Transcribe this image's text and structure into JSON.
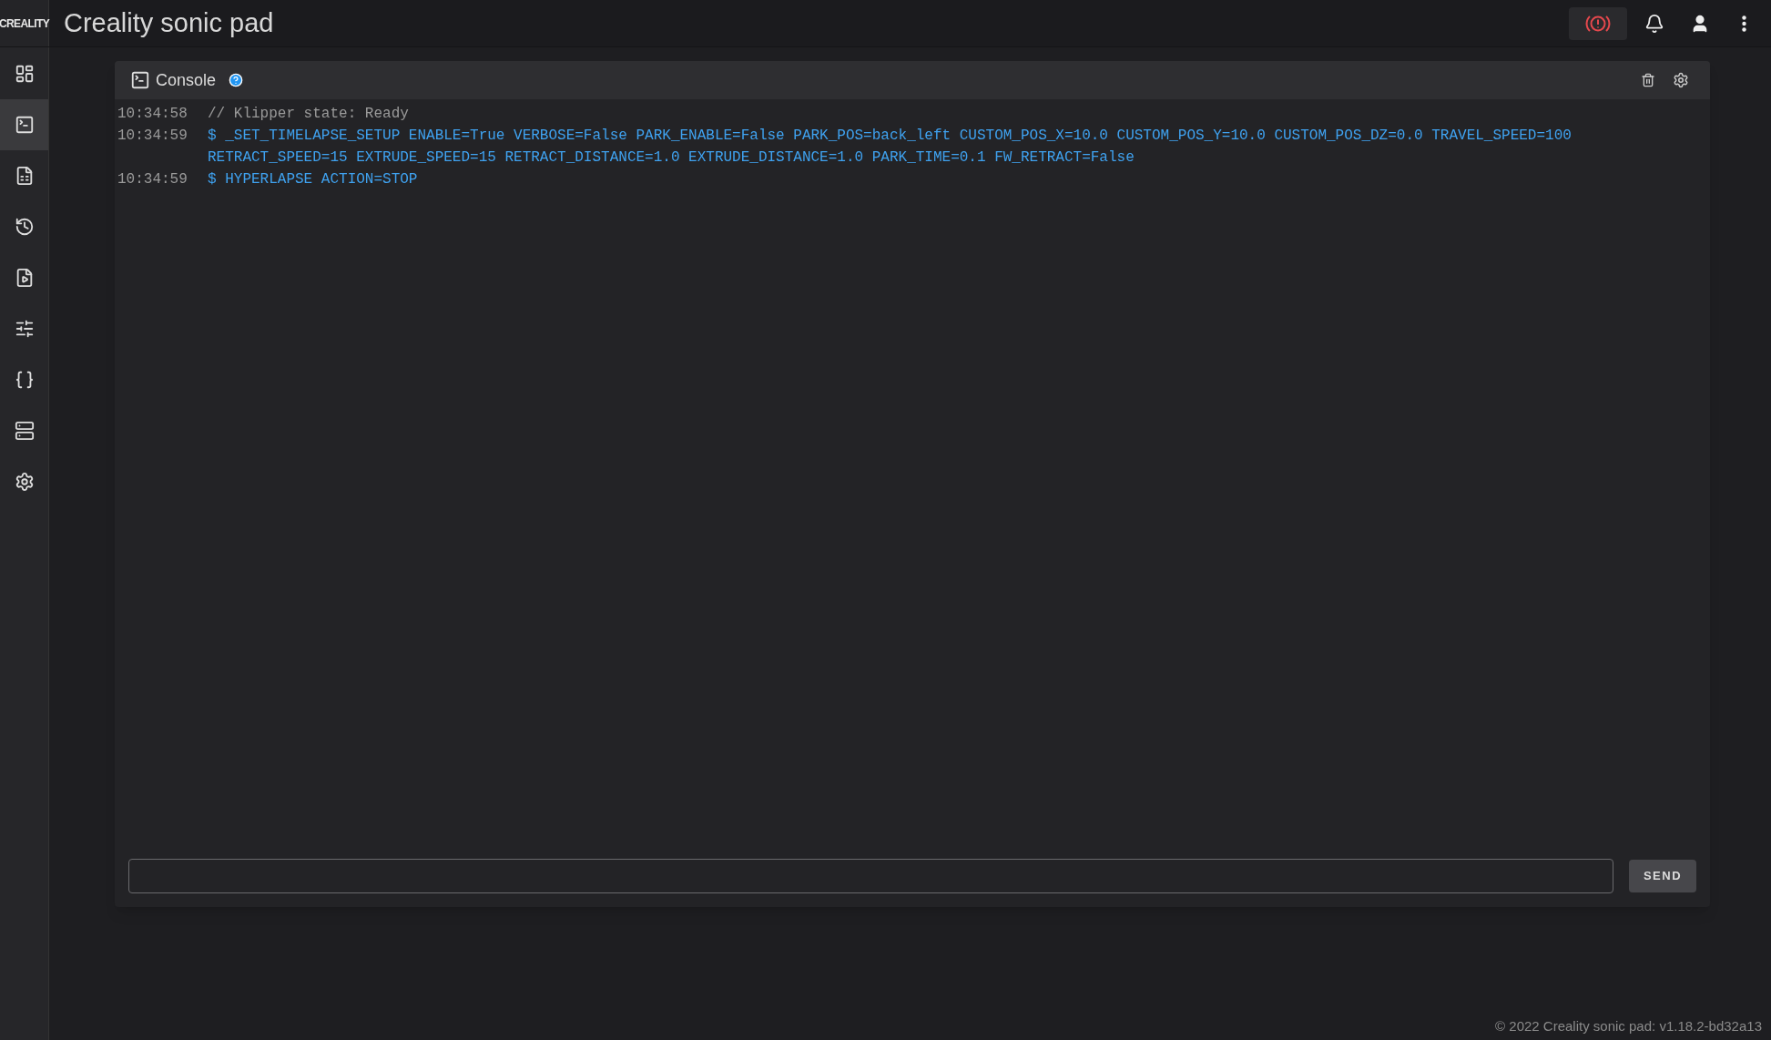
{
  "logo": "CREALITY",
  "app_title": "Creality sonic pad",
  "sidebar": {
    "items": [
      {
        "kind": "dashboard",
        "selected": false
      },
      {
        "kind": "console",
        "selected": true
      },
      {
        "kind": "files",
        "selected": false
      },
      {
        "kind": "history",
        "selected": false
      },
      {
        "kind": "timelapse",
        "selected": false
      },
      {
        "kind": "tune",
        "selected": false
      },
      {
        "kind": "macros",
        "selected": false
      },
      {
        "kind": "machine",
        "selected": false
      },
      {
        "kind": "settings",
        "selected": false
      }
    ]
  },
  "console": {
    "title": "Console",
    "entries": [
      {
        "time": "10:34:58",
        "kind": "response",
        "message": "// Klipper state: Ready"
      },
      {
        "time": "10:34:59",
        "kind": "command",
        "message": "$ _SET_TIMELAPSE_SETUP ENABLE=True VERBOSE=False PARK_ENABLE=False PARK_POS=back_left CUSTOM_POS_X=10.0 CUSTOM_POS_Y=10.0 CUSTOM_POS_DZ=0.0 TRAVEL_SPEED=100 RETRACT_SPEED=15 EXTRUDE_SPEED=15 RETRACT_DISTANCE=1.0 EXTRUDE_DISTANCE=1.0 PARK_TIME=0.1 FW_RETRACT=False"
      },
      {
        "time": "10:34:59",
        "kind": "command",
        "message": "$ HYPERLAPSE ACTION=STOP"
      }
    ],
    "send_button": "SEND"
  },
  "footer": "© 2022 Creality sonic pad: v1.18.2-bd32a13"
}
